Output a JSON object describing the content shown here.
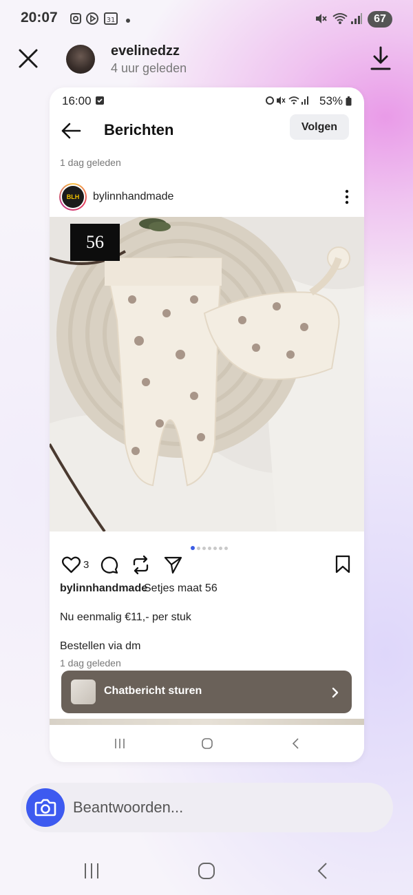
{
  "os_status": {
    "time": "20:07",
    "battery": "67"
  },
  "story": {
    "username": "evelinedzz",
    "time_ago": "4 uur geleden"
  },
  "screenshot": {
    "status_time": "16:00",
    "status_battery": "53%",
    "title": "Berichten",
    "follow_label": "Volgen",
    "time_ago": "1 dag geleden",
    "post": {
      "avatar_text": "BLH",
      "username": "bylinnhandmade",
      "size_tag": "56",
      "carousel_count": 7,
      "carousel_active": 0,
      "likes": "3",
      "caption_user": "bylinnhandmade",
      "caption_text": "Setjes maat 56",
      "caption_line2": "Nu eenmalig €11,- per stuk",
      "caption_line3": "Bestellen via dm",
      "time_ago": "1 dag geleden"
    },
    "chat_bar_label": "Chatbericht sturen"
  },
  "reply": {
    "placeholder": "Beantwoorden..."
  },
  "colors": {
    "accent": "#3d5af0",
    "chat_bar": "#6a6159",
    "carousel_active": "#3b5ce4"
  }
}
